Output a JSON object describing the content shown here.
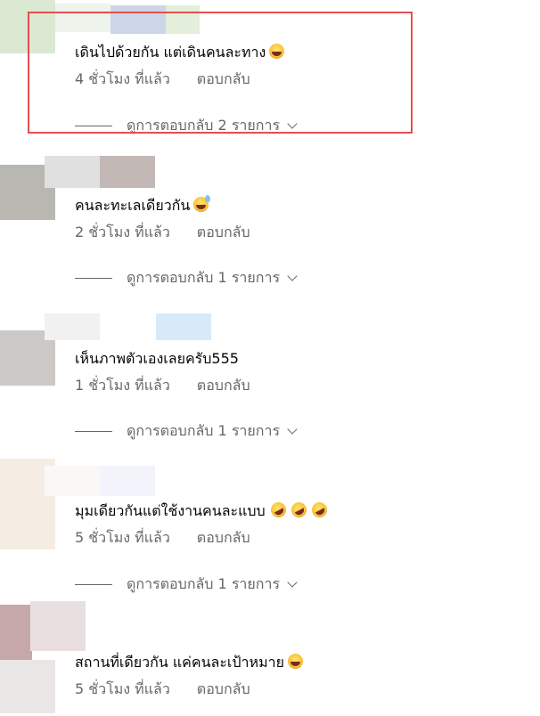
{
  "comments": [
    {
      "text": "เดินไปด้วยกัน แต่เดินคนละทาง",
      "emoji": [
        "grinning-squinting-face-icon"
      ],
      "time": "4 ชั่วโมง ที่แล้ว",
      "reply": "ตอบกลับ",
      "view_replies": "ดูการตอบกลับ 2 รายการ",
      "highlighted": true
    },
    {
      "text": "คนละทะเลเดียวกัน",
      "emoji": [
        "grinning-sweat-face-icon"
      ],
      "time": "2 ชั่วโมง ที่แล้ว",
      "reply": "ตอบกลับ",
      "view_replies": "ดูการตอบกลับ 1 รายการ"
    },
    {
      "text": "เห็นภาพตัวเองเลยครับ555",
      "emoji": [],
      "time": "1 ชั่วโมง ที่แล้ว",
      "reply": "ตอบกลับ",
      "view_replies": "ดูการตอบกลับ 1 รายการ"
    },
    {
      "text": "มุมเดียวกันแต่ใช้งานคนละแบบ",
      "emoji": [
        "rolling-on-floor-laughing-icon",
        "rolling-on-floor-laughing-icon",
        "rolling-on-floor-laughing-icon"
      ],
      "time": "5 ชั่วโมง ที่แล้ว",
      "reply": "ตอบกลับ",
      "view_replies": "ดูการตอบกลับ 1 รายการ"
    },
    {
      "text": "สถานที่เดียวกัน แค่คนละเป้าหมาย",
      "emoji": [
        "grinning-squinting-face-icon"
      ],
      "time": "5 ชั่วโมง ที่แล้ว",
      "reply": "ตอบกลับ"
    }
  ],
  "colors": {
    "text": "#050505",
    "meta": "#65676b",
    "highlight_border": "#e34f4f"
  }
}
